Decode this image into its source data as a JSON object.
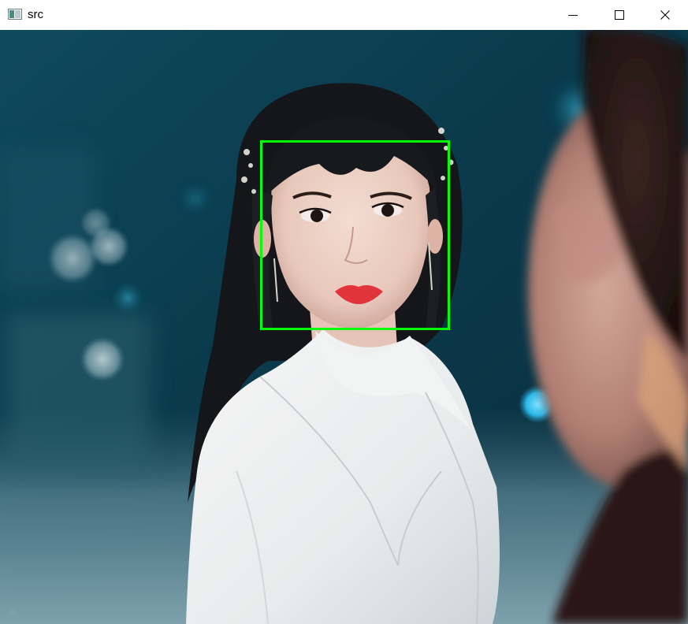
{
  "window": {
    "title": "src",
    "icon": "app-window-icon",
    "controls": {
      "minimize_icon": "minimize-icon",
      "maximize_icon": "maximize-icon",
      "close_icon": "close-icon"
    }
  },
  "image": {
    "description_icon": "photo-content",
    "detection_box_color": "#00ff00"
  }
}
